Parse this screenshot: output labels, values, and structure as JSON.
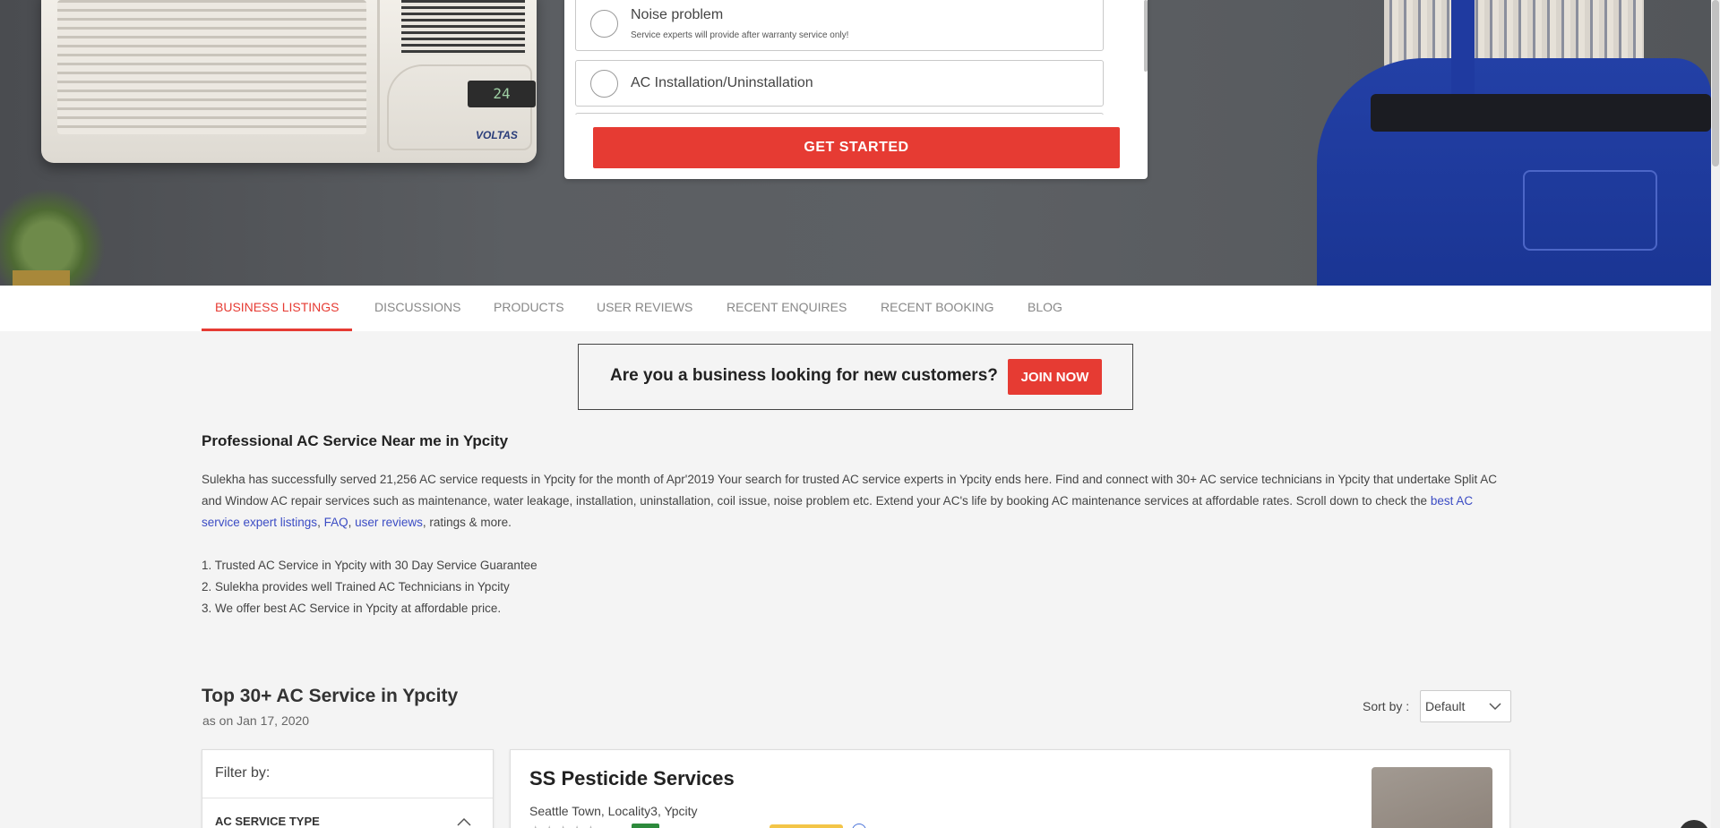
{
  "hero": {
    "ac_display": "24",
    "ac_brand": "VOLTAS"
  },
  "form": {
    "options": [
      {
        "title": "Noise problem",
        "subtitle": "Service experts will provide after warranty service only!"
      },
      {
        "title": "AC Installation/Uninstallation"
      }
    ],
    "cta_label": "GET STARTED"
  },
  "tabs": [
    {
      "label": "BUSINESS LISTINGS",
      "active": true
    },
    {
      "label": "DISCUSSIONS"
    },
    {
      "label": "PRODUCTS"
    },
    {
      "label": "USER REVIEWS"
    },
    {
      "label": "RECENT ENQUIRES"
    },
    {
      "label": "RECENT BOOKING"
    },
    {
      "label": "BLOG"
    }
  ],
  "join_banner": {
    "text": "Are you a business looking for new customers?",
    "button_label": "JOIN NOW"
  },
  "description": {
    "title": "Professional AC Service Near me in Ypcity",
    "paragraph_text": "Sulekha has successfully served 21,256 AC service requests in Ypcity for the month of Apr'2019 Your search for trusted AC service experts in Ypcity ends here. Find and connect with 30+ AC service technicians in Ypcity that undertake Split AC and Window AC repair services such as maintenance, water leakage, installation, uninstallation, coil issue, noise problem etc. Extend your AC's life by booking AC maintenance services at affordable rates. Scroll down to check the",
    "link_listings": "best AC service expert listings",
    "comma1": ", ",
    "link_faq": "FAQ",
    "comma2": ", ",
    "link_reviews": "user reviews",
    "paragraph_tail": ", ratings & more.",
    "points": [
      "1. Trusted AC Service in Ypcity with 30 Day Service Guarantee",
      "2. Sulekha provides well Trained AC Technicians in Ypcity",
      "3. We offer best AC Service in Ypcity at affordable price."
    ]
  },
  "listing_header": {
    "title": "Top 30+ AC Service in Ypcity",
    "date": "as on Jan 17, 2020",
    "sort_label": "Sort by :",
    "sort_value": "Default"
  },
  "filter": {
    "heading": "Filter by:",
    "section": "AC SERVICE TYPE"
  },
  "listing": {
    "name": "SS Pesticide Services",
    "location": "Seattle Town, Locality3, Ypcity",
    "stars": "★★★★★"
  },
  "colors": {
    "accent": "#e63b33",
    "link": "#3b4cc4",
    "rating_green": "#2d8a3c"
  }
}
